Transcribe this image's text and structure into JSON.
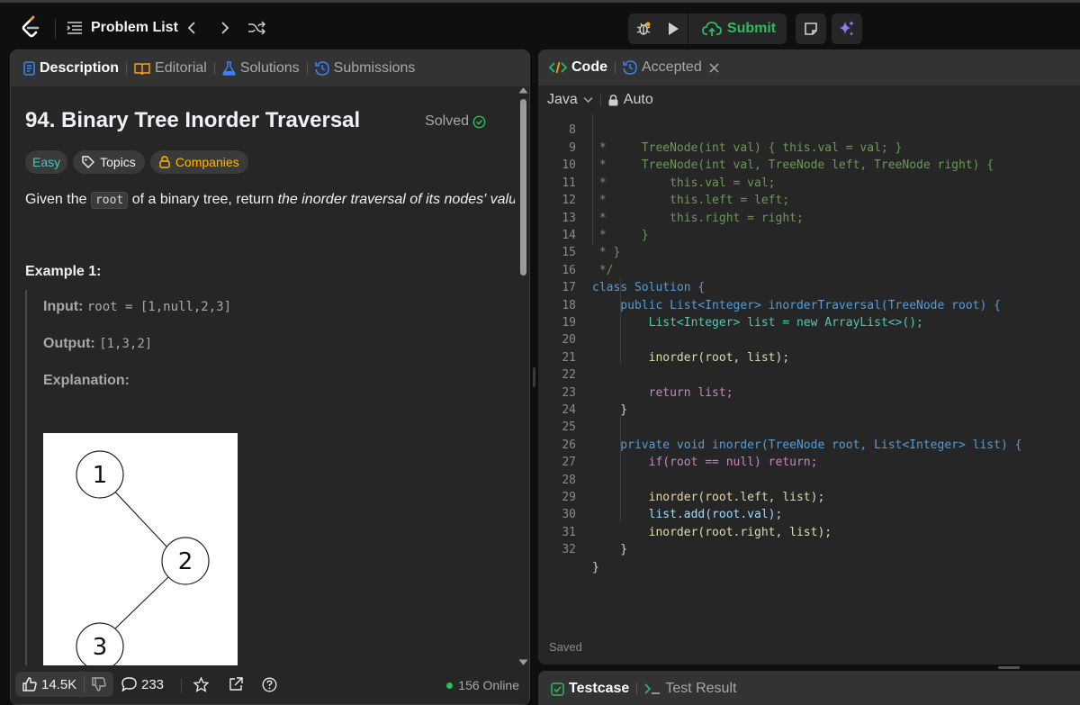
{
  "topbar": {
    "problem_list_label": "Problem List",
    "submit_label": "Submit"
  },
  "left_panel": {
    "tabs": [
      {
        "label": "Description"
      },
      {
        "label": "Editorial"
      },
      {
        "label": "Solutions"
      },
      {
        "label": "Submissions"
      }
    ],
    "title": "94. Binary Tree Inorder Traversal",
    "solved_label": "Solved",
    "chips": {
      "difficulty": "Easy",
      "topics": "Topics",
      "companies": "Companies"
    },
    "statement": {
      "pre": "Given the ",
      "code": "root",
      "mid": " of a binary tree, return ",
      "em": "the inorder traversal of its nodes' values",
      "post": "."
    },
    "example": {
      "title": "Example 1:",
      "input_label": "Input:",
      "input_value": "root = [1,null,2,3]",
      "output_label": "Output:",
      "output_value": "[1,3,2]",
      "explanation_label": "Explanation:",
      "tree_nodes": [
        "1",
        "2",
        "3"
      ]
    },
    "footer": {
      "likes": "14.5K",
      "comments": "233",
      "online": "156 Online"
    }
  },
  "right_panel": {
    "tabs": [
      {
        "label": "Code"
      },
      {
        "label": "Accepted"
      }
    ],
    "language": "Java",
    "mode": "Auto",
    "code_lines": [
      {
        "n": "8",
        "text": " *     TreeNode(int val) { this.val = val; }"
      },
      {
        "n": "9",
        "text": " *     TreeNode(int val, TreeNode left, TreeNode right) {"
      },
      {
        "n": "10",
        "text": " *         this.val = val;"
      },
      {
        "n": "11",
        "text": " *         this.left = left;"
      },
      {
        "n": "12",
        "text": " *         this.right = right;"
      },
      {
        "n": "13",
        "text": " *     }"
      },
      {
        "n": "14",
        "text": " * }"
      },
      {
        "n": "15",
        "text": " */"
      },
      {
        "n": "16",
        "text": "class Solution {"
      },
      {
        "n": "17",
        "text": "    public List<Integer> inorderTraversal(TreeNode root) {"
      },
      {
        "n": "18",
        "text": "        List<Integer> list = new ArrayList<>();"
      },
      {
        "n": "19",
        "text": ""
      },
      {
        "n": "20",
        "text": "        inorder(root, list);"
      },
      {
        "n": "21",
        "text": ""
      },
      {
        "n": "22",
        "text": "        return list;"
      },
      {
        "n": "23",
        "text": "    }"
      },
      {
        "n": "24",
        "text": ""
      },
      {
        "n": "25",
        "text": "    private void inorder(TreeNode root, List<Integer> list) {"
      },
      {
        "n": "26",
        "text": "        if(root == null) return;"
      },
      {
        "n": "27",
        "text": ""
      },
      {
        "n": "28",
        "text": "        inorder(root.left, list);"
      },
      {
        "n": "29",
        "text": "        list.add(root.val);"
      },
      {
        "n": "30",
        "text": "        inorder(root.right, list);"
      },
      {
        "n": "31",
        "text": "    }"
      },
      {
        "n": "32",
        "text": "}"
      }
    ],
    "saved_label": "Saved"
  },
  "bottom_panel": {
    "tabs": [
      {
        "label": "Testcase"
      },
      {
        "label": "Test Result"
      }
    ]
  },
  "colors": {
    "accent_green": "#2cbb5d",
    "easy_teal": "#46c6c2",
    "companies_yellow": "#ffb800",
    "code_tab_orange": "#ffa116",
    "submissions_blue": "#3b82f6"
  },
  "icons": [
    "leetcode-logo-icon",
    "list-icon",
    "chevron-left-icon",
    "chevron-right-icon",
    "shuffle-icon",
    "debug-icon",
    "play-icon",
    "upload-cloud-icon",
    "note-icon",
    "sparkle-icon",
    "document-icon",
    "book-icon",
    "flask-icon",
    "history-icon",
    "check-circle-icon",
    "tag-icon",
    "lock-icon",
    "code-icon",
    "close-icon",
    "chevron-down-icon",
    "thumbs-up-icon",
    "thumbs-down-icon",
    "comment-icon",
    "star-icon",
    "share-icon",
    "help-icon",
    "checkbox-icon",
    "terminal-icon"
  ]
}
